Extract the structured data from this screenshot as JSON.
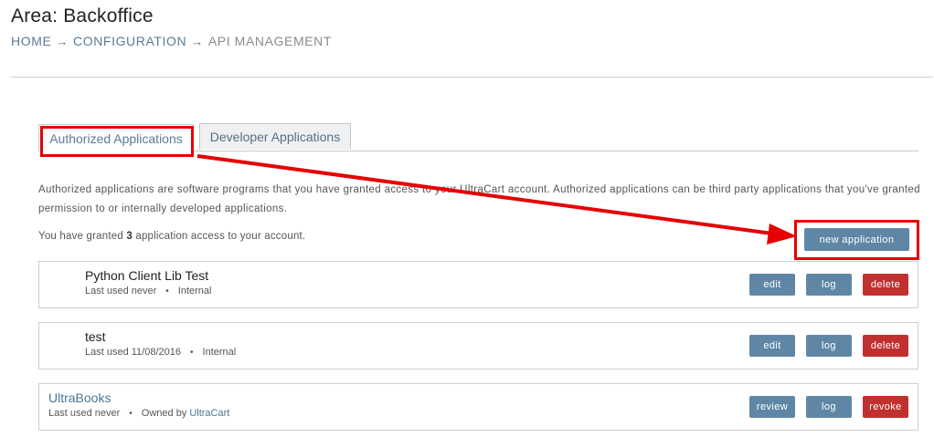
{
  "header": {
    "title": "Area: Backoffice",
    "breadcrumb": [
      "HOME",
      "CONFIGURATION",
      "API MANAGEMENT"
    ],
    "separator": "→"
  },
  "tabs": [
    {
      "label": "Authorized Applications",
      "active": true
    },
    {
      "label": "Developer Applications",
      "active": false
    }
  ],
  "description": "Authorized applications are software programs that you have granted access to your UltraCart account. Authorized applications can be third party applications that you've granted permission to or internally developed applications.",
  "granted": {
    "prefix": "You have granted ",
    "count": "3",
    "suffix": " application access to your account."
  },
  "new_application_label": "new application",
  "applications": [
    {
      "name": "Python Client Lib Test",
      "last_used": "Last used never",
      "type": "Internal",
      "actions": [
        "edit",
        "log",
        "delete"
      ]
    },
    {
      "name": "test",
      "last_used": "Last used 11/08/2016",
      "type": "Internal",
      "actions": [
        "edit",
        "log",
        "delete"
      ]
    },
    {
      "name": "UltraBooks",
      "last_used": "Last used never",
      "owner_prefix": "Owned by",
      "owner": "UltraCart",
      "actions": [
        "review",
        "log",
        "revoke"
      ]
    }
  ],
  "colors": {
    "accent": "#5f87a5",
    "danger": "#c0302f",
    "annotation": "#e60000"
  }
}
